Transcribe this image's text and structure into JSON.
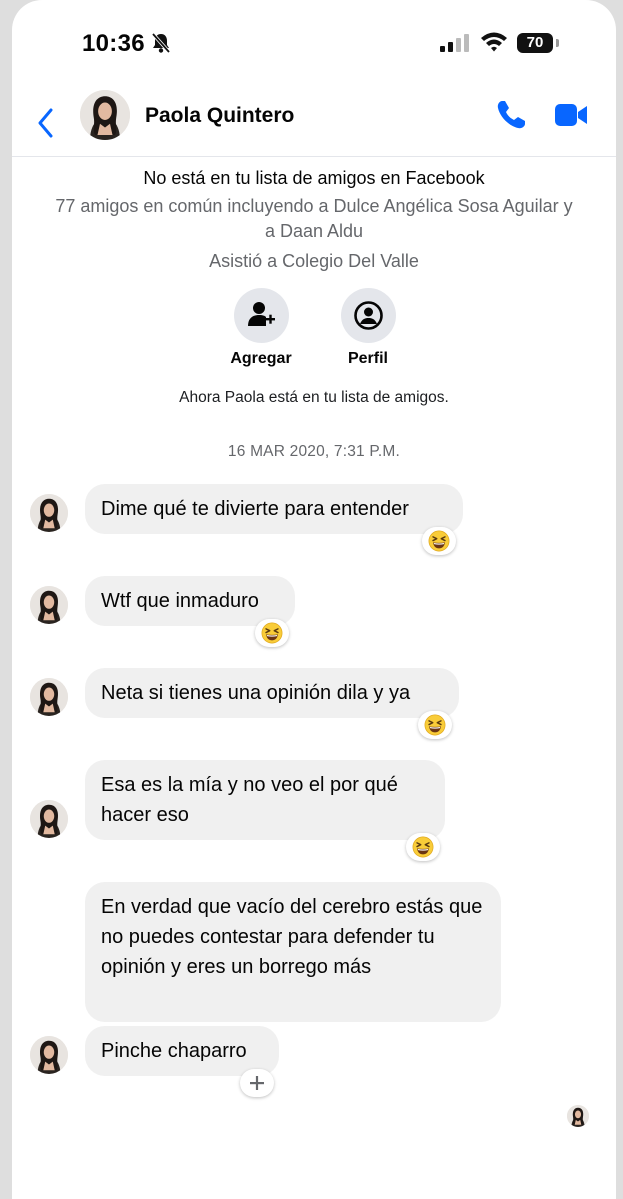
{
  "status": {
    "time": "10:36",
    "battery": "70"
  },
  "header": {
    "name": "Paola Quintero"
  },
  "profile_info": {
    "not_friend": "No está en tu lista de amigos en Facebook",
    "mutual": "77 amigos en común incluyendo a Dulce Angélica Sosa Aguilar y a Daan Aldu",
    "school": "Asistió a Colegio Del Valle"
  },
  "actions": {
    "add_label": "Agregar",
    "profile_label": "Perfil"
  },
  "friends_now": "Ahora Paola está en tu lista de amigos.",
  "timestamp": "16 MAR 2020, 7:31 P.M.",
  "messages": [
    {
      "text": "Dime qué te divierte para entender",
      "reaction": "laughing-squint-emoji"
    },
    {
      "text": "Wtf que inmaduro",
      "reaction": "laughing-squint-emoji"
    },
    {
      "text": "Neta si tienes una opinión dila y ya",
      "reaction": "laughing-squint-emoji"
    },
    {
      "text": "Esa es la mía y no veo el por qué hacer eso",
      "reaction": "laughing-squint-emoji"
    },
    {
      "text": "En verdad que vacío del cerebro estás que no puedes contestar para defender tu opinión y eres un borrego más",
      "reaction": null
    },
    {
      "text": "Pinche chaparro",
      "reaction": "add-reaction"
    }
  ],
  "colors": {
    "accent": "#0866ff",
    "bubble": "#f0f0f0",
    "secondary_text": "#65676b"
  }
}
